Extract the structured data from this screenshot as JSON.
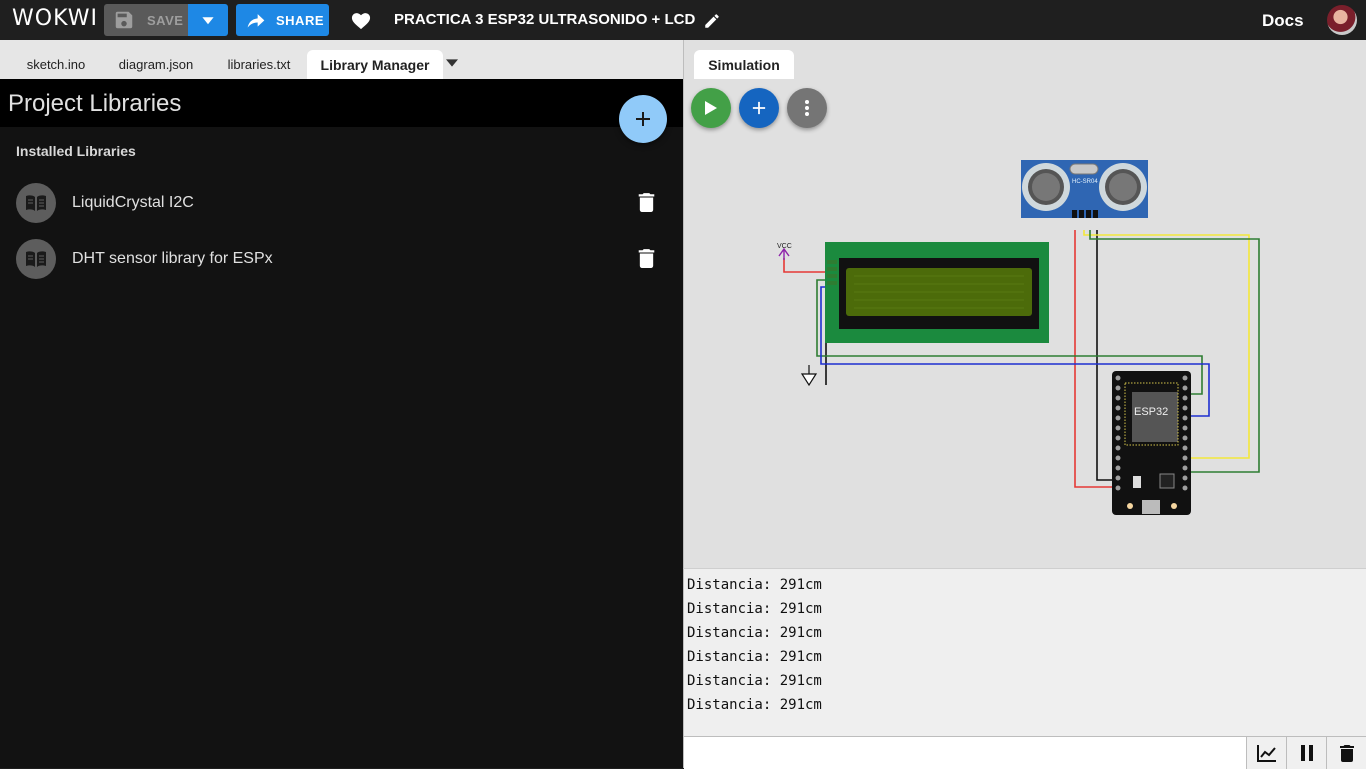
{
  "topbar": {
    "logo": "WOKWI",
    "save_label": "SAVE",
    "share_label": "SHARE",
    "project_title": "PRACTICA 3 ESP32 ULTRASONIDO + LCD",
    "docs_label": "Docs"
  },
  "editor_tabs": [
    "sketch.ino",
    "diagram.json",
    "libraries.txt",
    "Library Manager"
  ],
  "library_manager": {
    "title": "Project Libraries",
    "section_label": "Installed Libraries",
    "libraries": [
      "LiquidCrystal I2C",
      "DHT sensor library for ESPx"
    ]
  },
  "simulation": {
    "tab_label": "Simulation",
    "sensor_label": "HC-SR04",
    "board_label": "ESP32",
    "vcc_label": "VCC",
    "colors": {
      "play": "#43a047",
      "add": "#1565c0",
      "more": "#757575",
      "lcd_board": "#1b8a3e",
      "lcd_screen": "#4c6b0a"
    }
  },
  "serial": {
    "lines": [
      "Distancia: 291cm",
      "Distancia: 291cm",
      "Distancia: 291cm",
      "Distancia: 291cm",
      "Distancia: 291cm",
      "Distancia: 291cm"
    ],
    "input_value": ""
  }
}
